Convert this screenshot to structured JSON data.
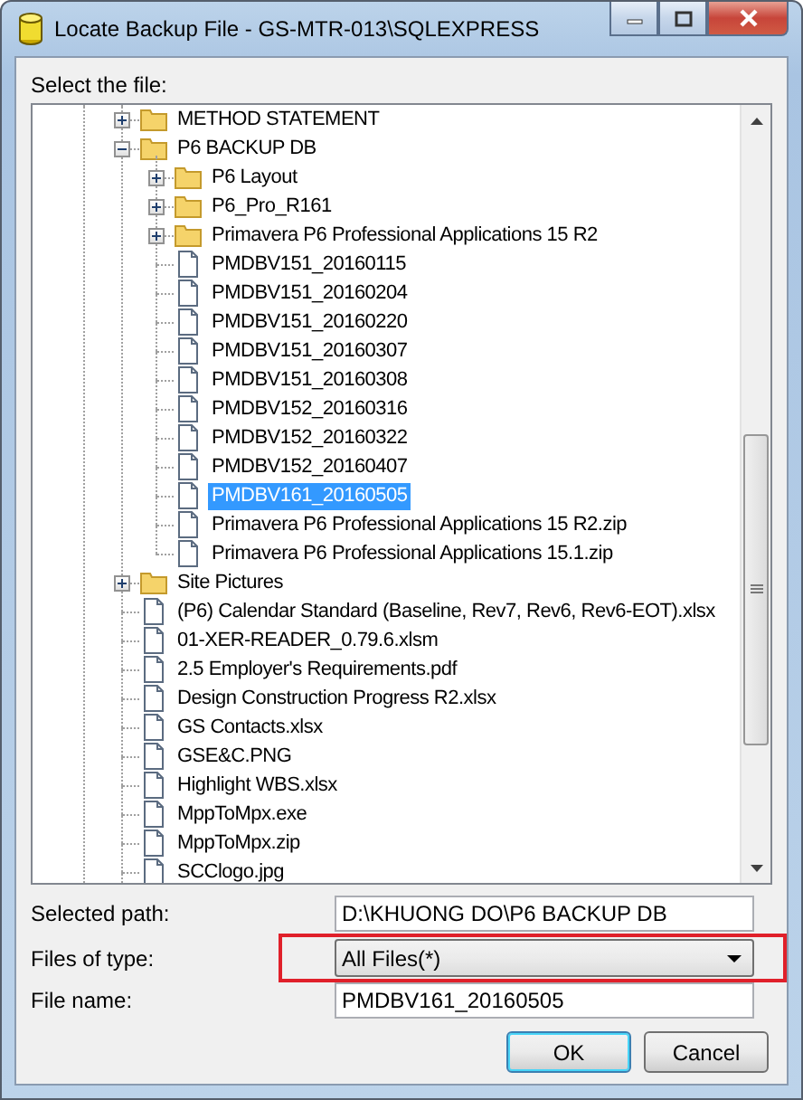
{
  "window": {
    "title": "Locate Backup File - GS-MTR-013\\SQLEXPRESS"
  },
  "tree_label": "Select the file:",
  "tree": [
    {
      "label": "METHOD STATEMENT",
      "kind": "folder",
      "expanded": false,
      "selected": false
    },
    {
      "label": "P6 BACKUP DB",
      "kind": "folder",
      "expanded": true,
      "selected": false,
      "children": [
        {
          "label": "P6 Layout",
          "kind": "folder",
          "expanded": false,
          "selected": false
        },
        {
          "label": "P6_Pro_R161",
          "kind": "folder",
          "expanded": false,
          "selected": false
        },
        {
          "label": "Primavera P6 Professional Applications 15 R2",
          "kind": "folder",
          "expanded": false,
          "selected": false
        },
        {
          "label": "PMDBV151_20160115",
          "kind": "file",
          "selected": false
        },
        {
          "label": "PMDBV151_20160204",
          "kind": "file",
          "selected": false
        },
        {
          "label": "PMDBV151_20160220",
          "kind": "file",
          "selected": false
        },
        {
          "label": "PMDBV151_20160307",
          "kind": "file",
          "selected": false
        },
        {
          "label": "PMDBV151_20160308",
          "kind": "file",
          "selected": false
        },
        {
          "label": "PMDBV152_20160316",
          "kind": "file",
          "selected": false
        },
        {
          "label": "PMDBV152_20160322",
          "kind": "file",
          "selected": false
        },
        {
          "label": "PMDBV152_20160407",
          "kind": "file",
          "selected": false
        },
        {
          "label": "PMDBV161_20160505",
          "kind": "file",
          "selected": true
        },
        {
          "label": "Primavera P6 Professional Applications 15 R2.zip",
          "kind": "file",
          "selected": false
        },
        {
          "label": "Primavera P6 Professional Applications 15.1.zip",
          "kind": "file",
          "selected": false
        }
      ]
    },
    {
      "label": "Site Pictures",
      "kind": "folder",
      "expanded": false,
      "selected": false
    },
    {
      "label": "(P6) Calendar Standard (Baseline, Rev7, Rev6, Rev6-EOT).xlsx",
      "kind": "file",
      "selected": false
    },
    {
      "label": "01-XER-READER_0.79.6.xlsm",
      "kind": "file",
      "selected": false
    },
    {
      "label": "2.5 Employer's Requirements.pdf",
      "kind": "file",
      "selected": false
    },
    {
      "label": "Design Construction Progress R2.xlsx",
      "kind": "file",
      "selected": false
    },
    {
      "label": "GS Contacts.xlsx",
      "kind": "file",
      "selected": false
    },
    {
      "label": "GSE&C.PNG",
      "kind": "file",
      "selected": false
    },
    {
      "label": "Highlight WBS.xlsx",
      "kind": "file",
      "selected": false
    },
    {
      "label": "MppToMpx.exe",
      "kind": "file",
      "selected": false
    },
    {
      "label": "MppToMpx.zip",
      "kind": "file",
      "selected": false
    },
    {
      "label": "SCClogo.jpg",
      "kind": "file",
      "selected": false
    }
  ],
  "fields": [
    {
      "label": "Selected path:",
      "kind": "text",
      "value": "D:\\KHUONG DO\\P6 BACKUP DB",
      "highlighted": false
    },
    {
      "label": "Files of type:",
      "kind": "dropdown",
      "value": "All Files(*)",
      "highlighted": true
    },
    {
      "label": "File name:",
      "kind": "text",
      "value": "PMDBV161_20160505",
      "highlighted": false
    }
  ],
  "buttons": [
    {
      "label": "OK",
      "default": true
    },
    {
      "label": "Cancel",
      "default": false
    }
  ]
}
